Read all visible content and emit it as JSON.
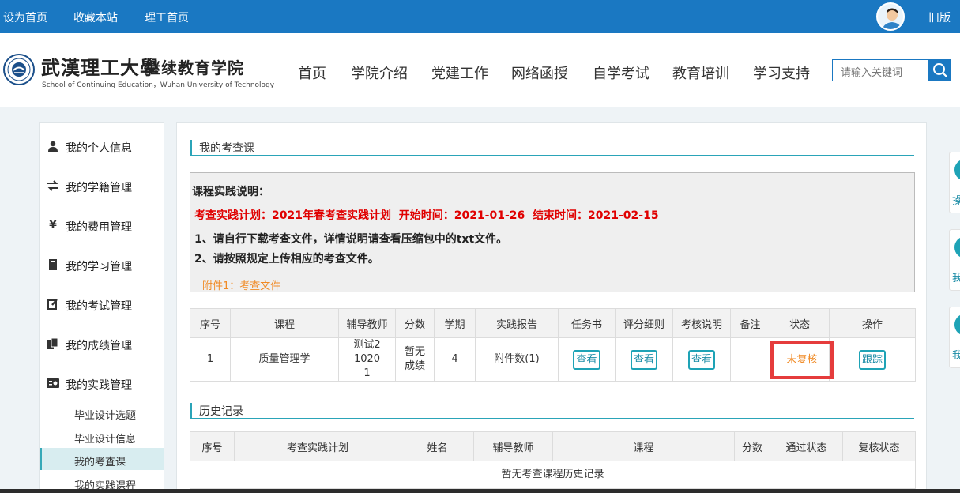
{
  "topbar": {
    "set_home": "设为首页",
    "bookmark": "收藏本站",
    "ligong_home": "理工首页",
    "old_version": "旧版"
  },
  "header": {
    "logo_cn": "武漢理工大學",
    "logo_sub": "继续教育学院",
    "logo_en": "School of Continuing Education，Wuhan University of Technology",
    "nav": [
      "首页",
      "学院介绍",
      "党建工作",
      "网络函授",
      "自学考试",
      "教育培训",
      "学习支持"
    ],
    "search_placeholder": "请输入关键词"
  },
  "sidebar": {
    "items": [
      {
        "label": "我的个人信息",
        "icon": "user-icon"
      },
      {
        "label": "我的学籍管理",
        "icon": "transfer-icon"
      },
      {
        "label": "我的费用管理",
        "icon": "yen-icon"
      },
      {
        "label": "我的学习管理",
        "icon": "book-icon"
      },
      {
        "label": "我的考试管理",
        "icon": "edit-icon"
      },
      {
        "label": "我的成绩管理",
        "icon": "file-icon"
      },
      {
        "label": "我的实践管理",
        "icon": "practice-icon"
      }
    ],
    "sub_items": [
      "毕业设计选题",
      "毕业设计信息",
      "我的考查课",
      "我的实践课程"
    ],
    "active_sub": "我的考查课"
  },
  "main": {
    "section_title": "我的考查课",
    "notice": {
      "title": "课程实践说明：",
      "plan_line": "考查实践计划：2021年春考查实践计划  开始时间：2021-01-26  结束时间：2021-02-15",
      "line1": "1、请自行下载考查文件，详情说明请查看压缩包中的txt文件。",
      "line2": "2、请按照规定上传相应的考查文件。",
      "attachment": "附件1：考查文件"
    },
    "course_table": {
      "headers": [
        "序号",
        "课程",
        "辅导教师",
        "分数",
        "学期",
        "实践报告",
        "任务书",
        "评分细则",
        "考核说明",
        "备注",
        "状态",
        "操作"
      ],
      "row": {
        "index": "1",
        "course": "质量管理学",
        "teacher": "测试210201",
        "score": "暂无成绩",
        "term": "4",
        "report": "附件数(1)",
        "view": "查看",
        "remark": "",
        "status": "未复核",
        "action": "跟踪"
      }
    },
    "history_title": "历史记录",
    "history_table": {
      "headers": [
        "序号",
        "考查实践计划",
        "姓名",
        "辅导教师",
        "课程",
        "分数",
        "通过状态",
        "复核状态"
      ],
      "empty_text": "暂无考查课程历史记录"
    }
  },
  "right_widgets": [
    "操",
    "我",
    "我"
  ],
  "colors": {
    "brand_blue": "#1a78c2",
    "accent_teal": "#2aa4b8",
    "notice_red": "#e00000",
    "attachment_orange": "#f08a24",
    "highlight_red": "#e53c3c"
  }
}
